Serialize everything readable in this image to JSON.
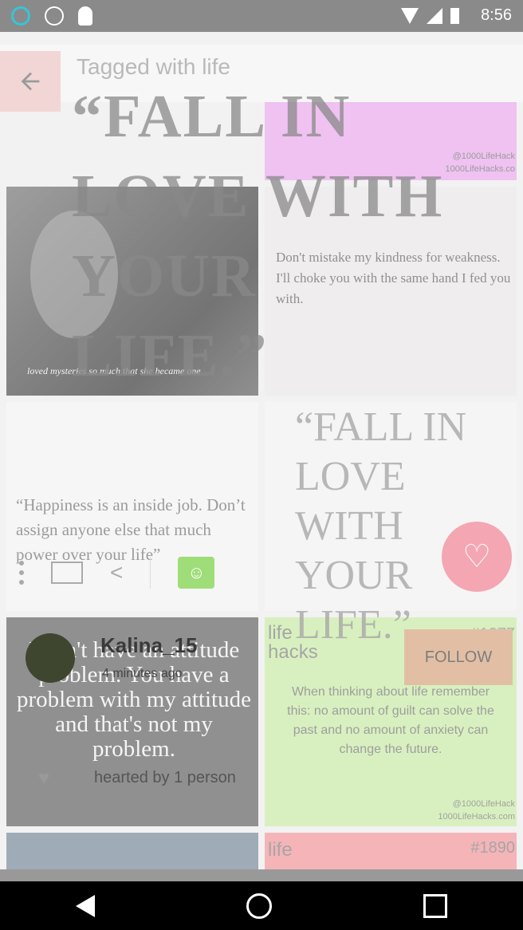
{
  "status_bar": {
    "time": "8:56"
  },
  "header": {
    "title": "Tagged with life"
  },
  "tiles": {
    "t1_watermark1": "@1000LifeHack",
    "t1_watermark2": "1000LifeHacks.co",
    "t2_caption": "loved mysteries so much that she became one",
    "t3_quote": "Don't mistake my kindness for weakness. I'll choke you with the same hand I fed you with.",
    "t4_quote": "“Happiness is an inside job. Don’t assign anyone else that much power over your life”",
    "big_quote": "“FALL IN LOVE WITH YOUR LIFE.”",
    "small_quote": "“FALL IN LOVE WITH YOUR LIFE.”",
    "t6_quote": "I don't have an attitude problem. You have a problem with my attitude and that's not my problem.",
    "t7_brand": "life hacks",
    "t7_number": "#1277",
    "t7_quote": "When thinking about life remember this: no amount of guilt can solve the past and no amount of anxiety can change the future.",
    "t7_watermark1": "@1000LifeHack",
    "t7_watermark2": "1000LifeHacks.com",
    "t9_brand": "life",
    "t9_number": "#1890"
  },
  "post": {
    "username": "Kalina_15",
    "time_ago": "4 minutes ago",
    "hearted_by": "hearted by 1 person",
    "follow_label": "FOLLOW"
  },
  "colors": {
    "accent": "#f4a6b3",
    "statusbar": "#8a8a8a",
    "follow": "#e2bfa4"
  }
}
